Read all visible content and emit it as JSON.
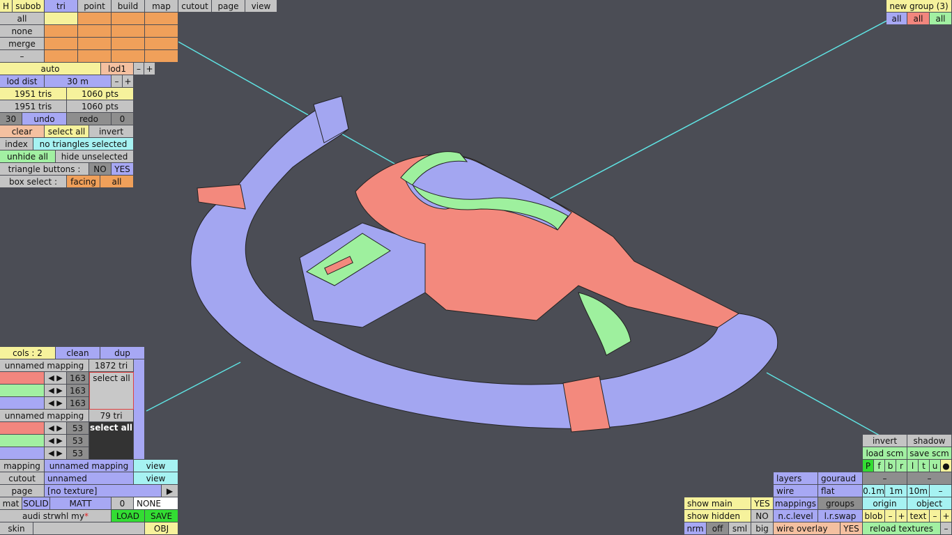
{
  "menubar": {
    "h": "H",
    "subob": "subob",
    "tri": "tri",
    "point": "point",
    "build": "build",
    "map": "map",
    "cutout": "cutout",
    "page": "page",
    "view": "view"
  },
  "groups": {
    "label": "new group (3)",
    "all1": "all",
    "all2": "all",
    "all3": "all"
  },
  "select": {
    "all": "all",
    "none": "none",
    "merge": "merge",
    "minus": "–"
  },
  "lod": {
    "auto": "auto",
    "lod": "lod1",
    "minus": "–",
    "plus": "+",
    "dist_label": "lod dist",
    "dist_val": "30 m"
  },
  "stats": {
    "tris1": "1951 tris",
    "pts1": "1060 pts",
    "tris2": "1951 tris",
    "pts2": "1060 pts"
  },
  "undo": {
    "count": "30",
    "undo": "undo",
    "redo": "redo",
    "redo_count": "0"
  },
  "sel": {
    "clear": "clear",
    "select_all": "select all",
    "invert": "invert",
    "index": "index",
    "info": "no triangles selected",
    "unhide": "unhide all",
    "hide_unsel": "hide unselected",
    "tri_buttons": "triangle buttons :",
    "no": "NO",
    "yes": "YES",
    "box": "box select :",
    "facing": "facing",
    "all": "all"
  },
  "cols": {
    "cols": "cols : 2",
    "clean": "clean",
    "dup": "dup"
  },
  "map1": {
    "name": "unnamed mapping",
    "tri": "1872 tri",
    "v1": "163",
    "v2": "163",
    "v3": "163",
    "select_all": "select all"
  },
  "map2": {
    "name": "unnamed mapping",
    "tri": "79 tri",
    "v1": "53",
    "v2": "53",
    "v3": "53",
    "select_all": "select all"
  },
  "props": {
    "mapping": "mapping",
    "mapping_val": "unnamed mapping",
    "view1": "view",
    "cutout": "cutout",
    "cutout_val": "unnamed",
    "view2": "view",
    "page": "page",
    "page_val": "[no texture]",
    "play": "▶",
    "mat": "mat",
    "solid": "SOLID",
    "matt": "MATT",
    "zero": "0",
    "none": "NONE",
    "file": "audi strwhl my",
    "star": "*",
    "load": "LOAD",
    "save": "SAVE",
    "skin": "skin",
    "obj": "OBJ"
  },
  "bottom": {
    "show_main": "show main",
    "yes1": "YES",
    "show_hidden": "show hidden",
    "no1": "NO",
    "nrm": "nrm",
    "off": "off",
    "sml": "sml",
    "big": "big",
    "layers": "layers",
    "gouraud": "gouraud",
    "wire": "wire",
    "flat": "flat",
    "mappings": "mappings",
    "groups": "groups",
    "nclevel": "n.c.level",
    "lrswap": "l.r.swap",
    "wire_overlay": "wire overlay",
    "yes2": "YES"
  },
  "right": {
    "invert": "invert",
    "shadow": "shadow",
    "load_scm": "load scm",
    "save_scm": "save scm",
    "views": [
      "P",
      "f",
      "b",
      "r",
      "l",
      "t",
      "u"
    ],
    "dot": "●",
    "minus1": "–",
    "minus2": "–",
    "m01": "0.1m",
    "m1": "1m",
    "m10": "10m",
    "minus3": "–",
    "origin": "origin",
    "object": "object",
    "blob": "blob",
    "bminus": "–",
    "bplus": "+",
    "text": "text",
    "tminus": "–",
    "tplus": "+",
    "reload": "reload textures",
    "rminus": "–"
  }
}
